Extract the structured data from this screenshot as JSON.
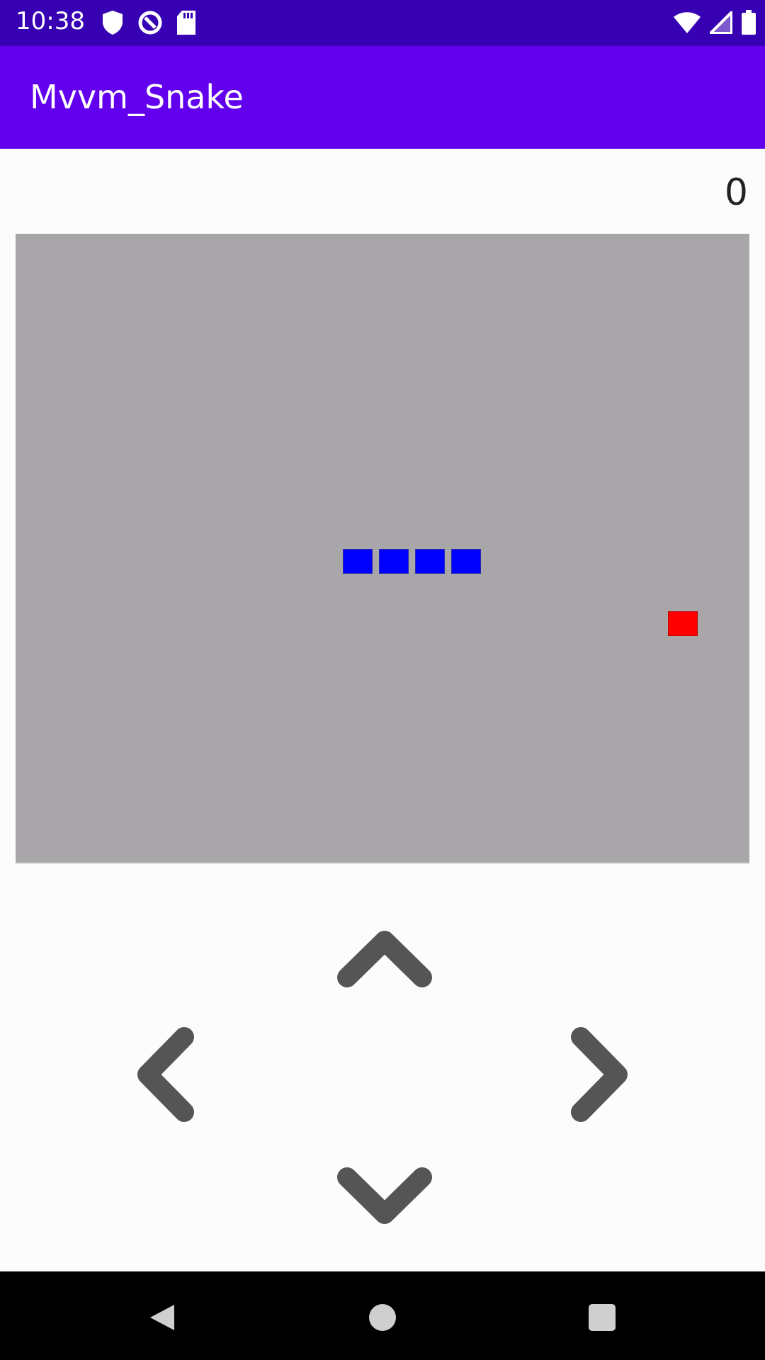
{
  "status_bar": {
    "time": "10:38",
    "left_icons": [
      "shield-icon",
      "sync-icon",
      "sd-card-icon"
    ],
    "right_icons": [
      "wifi-icon",
      "cell-signal-icon",
      "battery-icon"
    ]
  },
  "app_bar": {
    "title": "Mvvm_Snake"
  },
  "game": {
    "score": "0",
    "board_color": "#a8a6a9",
    "snake_color": "#0000ff",
    "food_color": "#ff0000"
  },
  "controls": {
    "up_icon": "chevron-up-icon",
    "down_icon": "chevron-down-icon",
    "left_icon": "chevron-left-icon",
    "right_icon": "chevron-right-icon",
    "icon_color": "#555555"
  },
  "nav_bar": {
    "back_icon": "back-triangle-icon",
    "home_icon": "home-circle-icon",
    "recents_icon": "recents-square-icon"
  }
}
